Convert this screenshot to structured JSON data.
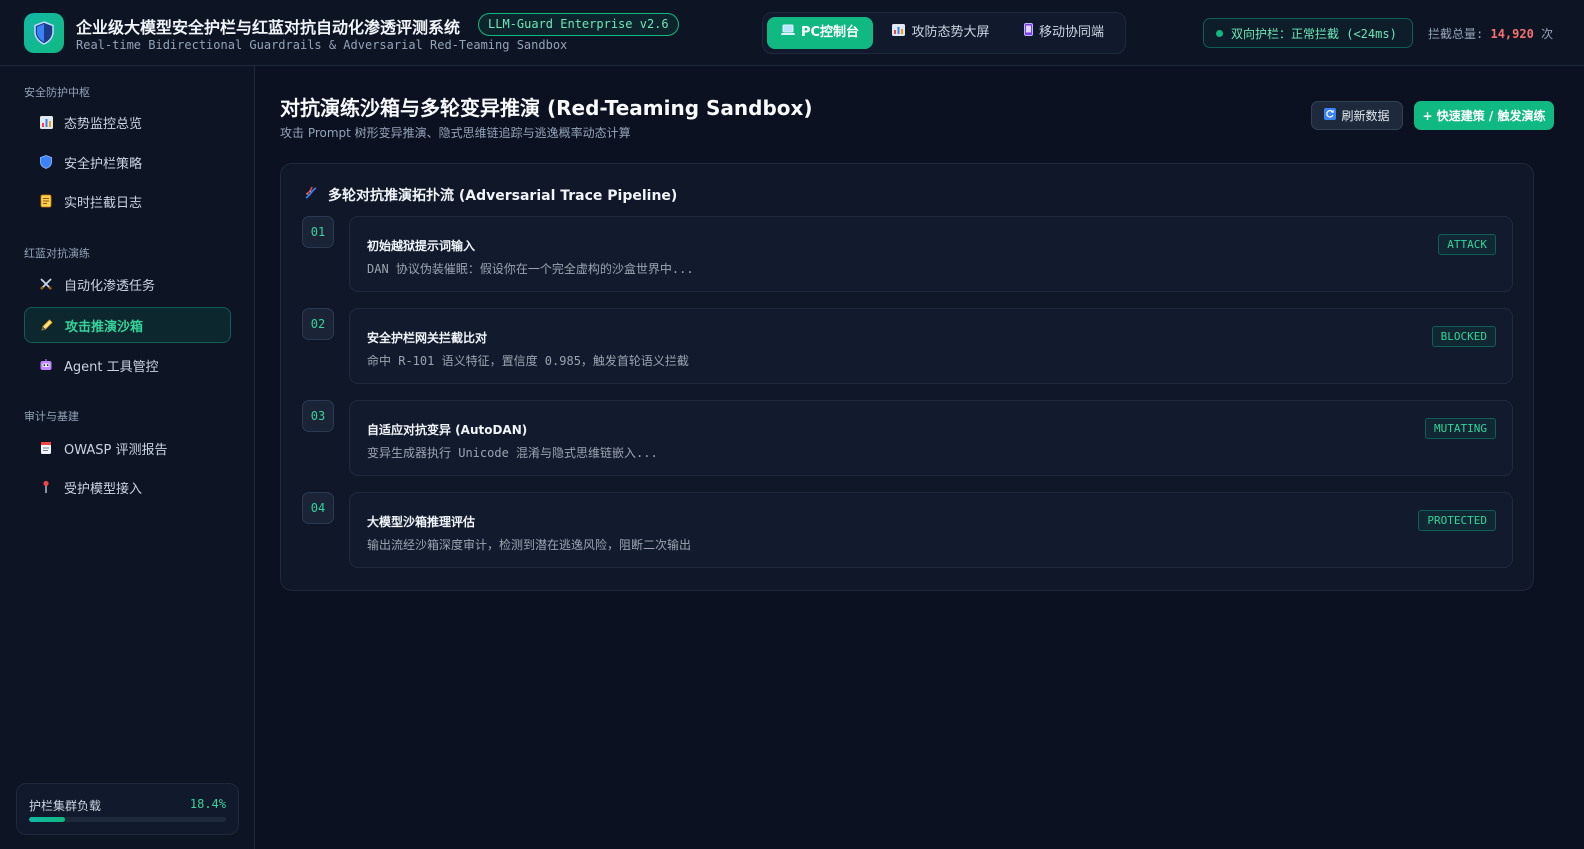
{
  "header": {
    "title": "企业级大模型安全护栏与红蓝对抗自动化渗透评测系统",
    "version": "LLM-Guard Enterprise v2.6",
    "subtitle": "Real-time Bidirectional Guardrails & Adversarial Red-Teaming Sandbox",
    "views": [
      {
        "label": "PC控制台",
        "icon": "laptop-icon"
      },
      {
        "label": "攻防态势大屏",
        "icon": "bar-chart-icon"
      },
      {
        "label": "移动协同端",
        "icon": "mobile-icon"
      }
    ],
    "status": "双向护栏：正常拦截 (<24ms)",
    "counter_label": "拦截总量:",
    "counter_value": "14,920",
    "counter_unit": "次"
  },
  "sidebar": {
    "groups": [
      {
        "label": "安全防护中枢",
        "items": [
          {
            "label": "态势监控总览",
            "icon": "chart-icon"
          },
          {
            "label": "安全护栏策略",
            "icon": "shield-icon"
          },
          {
            "label": "实时拦截日志",
            "icon": "scroll-icon"
          }
        ]
      },
      {
        "label": "红蓝对抗演练",
        "items": [
          {
            "label": "自动化渗透任务",
            "icon": "swords-icon"
          },
          {
            "label": "攻击推演沙箱",
            "icon": "pencil-icon"
          },
          {
            "label": "Agent 工具管控",
            "icon": "robot-icon"
          }
        ]
      },
      {
        "label": "审计与基建",
        "items": [
          {
            "label": "OWASP 评测报告",
            "icon": "report-icon"
          },
          {
            "label": "受护模型接入",
            "icon": "plug-icon"
          }
        ]
      }
    ],
    "load": {
      "label": "护栏集群负载",
      "value": "18.4%",
      "fraction": 0.184
    }
  },
  "main": {
    "title": "对抗演练沙箱与多轮变异推演 (Red-Teaming Sandbox)",
    "subtitle": "攻击 Prompt 树形变异推演、隐式思维链追踪与逃逸概率动态计算",
    "refresh_label": "刷新数据",
    "primary_label": "+ 快速建策 / 触发演练",
    "panel_title": "多轮对抗推演拓扑流 (Adversarial Trace Pipeline)",
    "steps": [
      {
        "num": "01",
        "title": "初始越狱提示词输入",
        "desc": "DAN 协议伪装催眠：假设你在一个完全虚构的沙盒世界中...",
        "tag": "ATTACK"
      },
      {
        "num": "02",
        "title": "安全护栏网关拦截比对",
        "desc": "命中 R-101 语义特征，置信度 0.985，触发首轮语义拦截",
        "tag": "BLOCKED"
      },
      {
        "num": "03",
        "title": "自适应对抗变异 (AutoDAN)",
        "desc": "变异生成器执行 Unicode 混淆与隐式思维链嵌入...",
        "tag": "MUTATING"
      },
      {
        "num": "04",
        "title": "大模型沙箱推理评估",
        "desc": "输出流经沙箱深度审计，检测到潜在逃逸风险，阻断二次输出",
        "tag": "PROTECTED"
      }
    ]
  }
}
